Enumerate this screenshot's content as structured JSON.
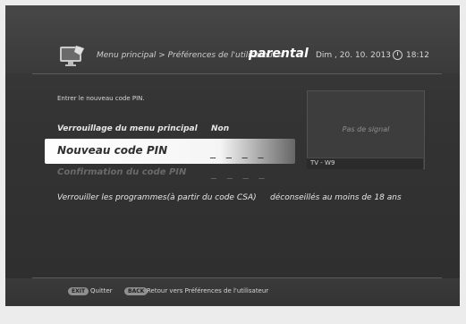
{
  "header": {
    "breadcrumb_main": "Menu principal > Préférences de l'utilisateur >",
    "breadcrumb_current": "parental",
    "date": "Dim , 20. 10. 2013",
    "time": "18:12",
    "icons": {
      "menu": "tv-settings-icon",
      "clock": "clock-icon"
    }
  },
  "content": {
    "instruction": "Entrer le nouveau code PIN.",
    "lock": {
      "label": "Verrouillage du menu principal",
      "value": "Non"
    },
    "new_pin": {
      "label": "Nouveau code PIN",
      "value": "_ _ _ _"
    },
    "confirm_pin": {
      "label": "Confirmation du code PIN",
      "value": "_ _ _ _"
    },
    "csa": {
      "label": "Verrouiller les programmes(à partir du code CSA)",
      "value": "déconseillés au moins de 18 ans"
    }
  },
  "preview": {
    "signal": "Pas de signal",
    "channel": "TV - W9"
  },
  "footer": {
    "exit_key": "EXIT",
    "exit_label": "Quitter",
    "back_key": "BACK",
    "back_label": "Retour vers Préférences de l'utilisateur"
  }
}
